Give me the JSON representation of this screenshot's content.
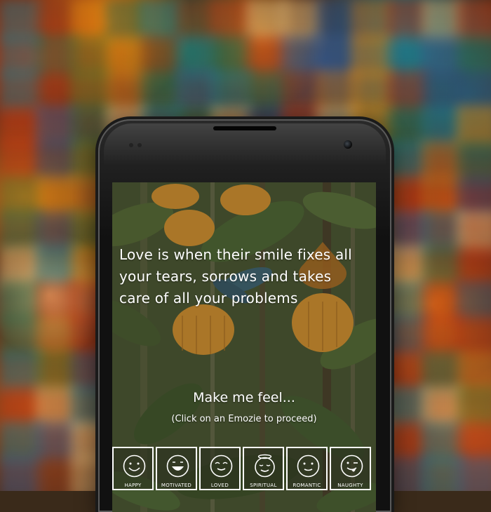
{
  "quote": {
    "lines": [
      "Love is when their smile fixes all",
      "your tears, sorrows and takes",
      "care of all your problems"
    ]
  },
  "prompt": {
    "title": "Make me feel...",
    "subtitle": "(Click on an Emozie to proceed)"
  },
  "emozies": [
    {
      "label": "HAPPY",
      "icon": "happy-face-icon"
    },
    {
      "label": "MOTIVATED",
      "icon": "grinning-face-icon"
    },
    {
      "label": "LOVED",
      "icon": "loved-face-icon"
    },
    {
      "label": "SPIRITUAL",
      "icon": "halo-face-icon"
    },
    {
      "label": "ROMANTIC",
      "icon": "romantic-face-icon"
    },
    {
      "label": "NAUGHTY",
      "icon": "naughty-face-icon"
    }
  ],
  "colors": {
    "text": "#ffffff",
    "leaf_green": "#5f7a3e",
    "flower_orange": "#f0a030"
  }
}
